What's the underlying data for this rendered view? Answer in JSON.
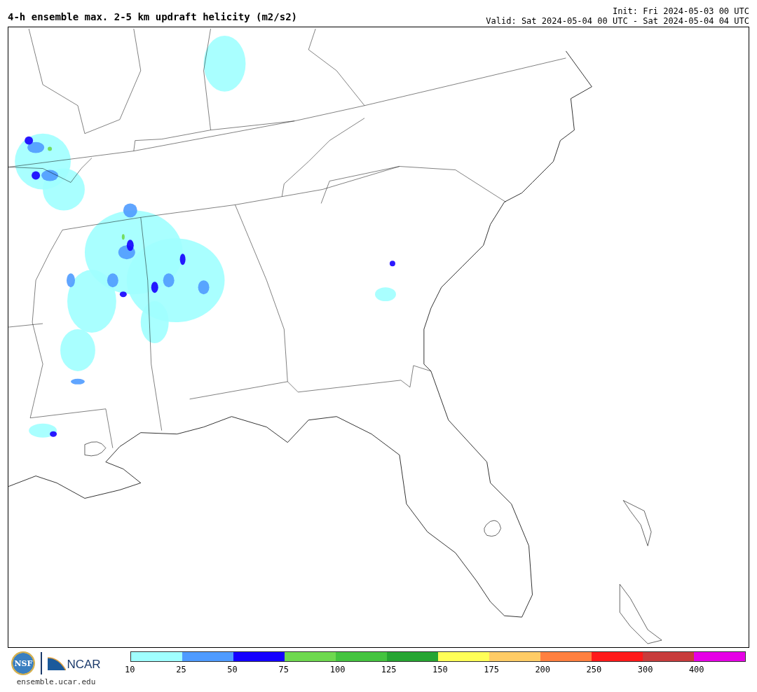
{
  "title": "4-h ensemble max. 2-5 km updraft helicity (m2/s2)",
  "init": "Init: Fri 2024-05-03 00 UTC",
  "valid": "Valid: Sat 2024-05-04 00 UTC - Sat 2024-05-04 04 UTC",
  "logos": {
    "nsf": "NSF",
    "ncar": "NCAR"
  },
  "website": "ensemble.ucar.edu",
  "legend": [
    {
      "label": "10",
      "color": "#a0ffff"
    },
    {
      "label": "25",
      "color": "#4f9bff"
    },
    {
      "label": "50",
      "color": "#1500ff"
    },
    {
      "label": "75",
      "color": "#6ed94f"
    },
    {
      "label": "100",
      "color": "#44c43f"
    },
    {
      "label": "125",
      "color": "#26a532"
    },
    {
      "label": "150",
      "color": "#ffff57"
    },
    {
      "label": "175",
      "color": "#ffcc66"
    },
    {
      "label": "200",
      "color": "#ff8040"
    },
    {
      "label": "250",
      "color": "#ff1a1a"
    },
    {
      "label": "300",
      "color": "#c83c3c"
    },
    {
      "label": "400",
      "color": "#e600e6"
    }
  ]
}
